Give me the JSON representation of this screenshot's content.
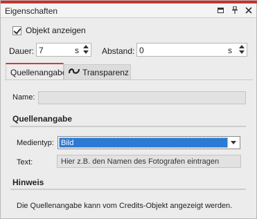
{
  "window": {
    "title": "Eigenschaften"
  },
  "title_icons": [
    "window-restore-icon",
    "pin-icon",
    "close-icon"
  ],
  "show_object": {
    "label": "Objekt anzeigen",
    "checked": true
  },
  "duration": {
    "label": "Dauer:",
    "value": "7",
    "unit": "s"
  },
  "spacing": {
    "label": "Abstand:",
    "value": "0",
    "unit": "s"
  },
  "tabs": [
    {
      "label": "Quellenangabe",
      "active": true
    },
    {
      "label": "Transparenz",
      "active": false,
      "icon": "transparency-icon"
    }
  ],
  "name_field": {
    "label": "Name:",
    "value": ""
  },
  "source_section": {
    "title": "Quellenangabe",
    "media_type": {
      "label": "Medientyp:",
      "selected": "Bild"
    },
    "text": {
      "label": "Text:",
      "placeholder": "Hier z.B. den Namen des Fotografen eintragen"
    }
  },
  "hint_section": {
    "title": "Hinweis",
    "text": "Die Quellenangabe kann vom Credits-Objekt angezeigt werden."
  },
  "colors": {
    "accent": "#d23a35",
    "selection": "#2b7ad4"
  }
}
